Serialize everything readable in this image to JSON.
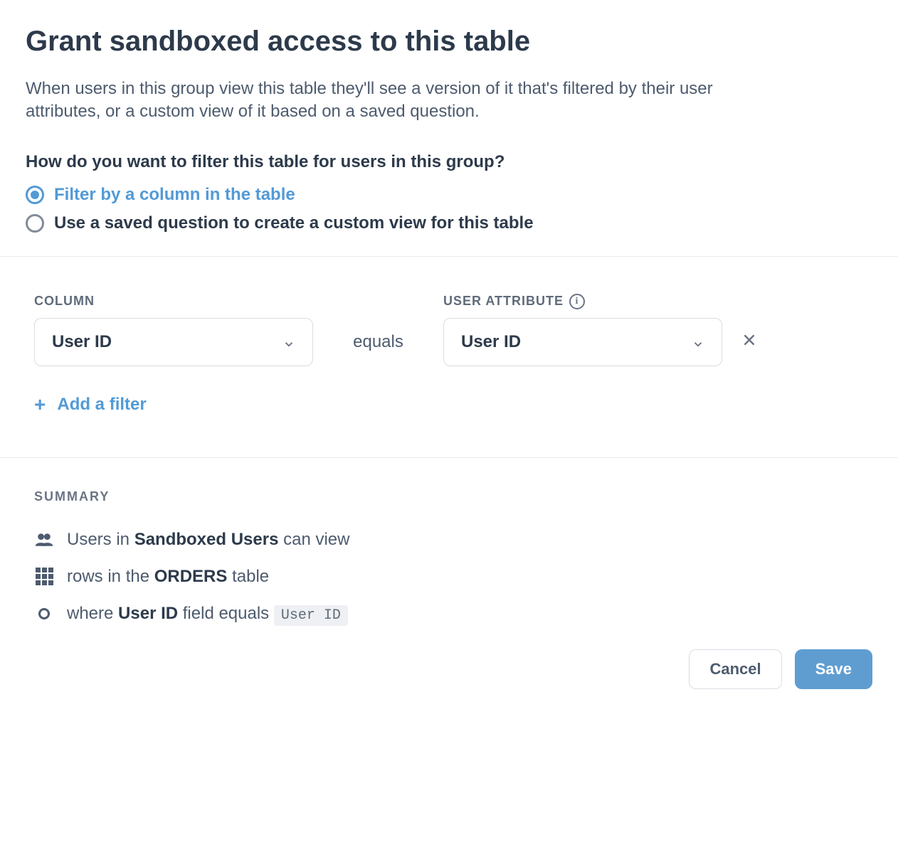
{
  "title": "Grant sandboxed access to this table",
  "intro": "When users in this group view this table they'll see a version of it that's filtered by their user attributes, or a custom view of it based on a saved question.",
  "filterQuestion": "How do you want to filter this table for users in this group?",
  "radio": {
    "option1": "Filter by a column in the table",
    "option2": "Use a saved question to create a custom view for this table",
    "selectedIndex": 0
  },
  "filter": {
    "columnHeader": "COLUMN",
    "userAttributeHeader": "USER ATTRIBUTE",
    "column": "User ID",
    "operator": "equals",
    "userAttribute": "User ID",
    "addFilterLabel": "Add a filter"
  },
  "summary": {
    "title": "SUMMARY",
    "line1_prefix": "Users in ",
    "line1_group": "Sandboxed Users",
    "line1_suffix": " can view",
    "line2_prefix": "rows in the ",
    "line2_table": "ORDERS",
    "line2_suffix": " table",
    "line3_prefix": "where ",
    "line3_field": "User ID",
    "line3_mid": " field equals ",
    "line3_attr": "User ID"
  },
  "footer": {
    "cancel": "Cancel",
    "save": "Save"
  }
}
